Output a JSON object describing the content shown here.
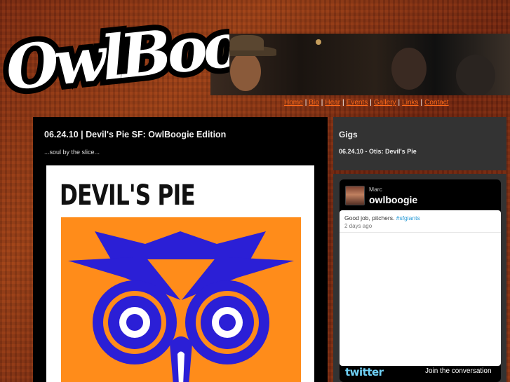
{
  "site": {
    "logo_text": "OwlBoogie"
  },
  "nav": {
    "items": [
      "Home",
      "Bio",
      "Hear",
      "Events",
      "Gallery",
      "Links",
      "Contact"
    ]
  },
  "post": {
    "title": "06.24.10 | Devil's Pie SF: OwlBoogie Edition",
    "subtitle": "...soul by the slice...",
    "poster_title": "DEVIL'S PIE"
  },
  "gigs": {
    "title": "Gigs",
    "item": "06.24.10 - Otis: Devil's Pie"
  },
  "twitter": {
    "name": "Marc",
    "handle": "owlboogie",
    "tweet_text": "Good job, pitchers. ",
    "tweet_hashtag": "#sfgiants",
    "tweet_time": "2 days ago",
    "logo": "twitter",
    "join": "Join the conversation"
  },
  "colors": {
    "accent": "#ff6a1a",
    "poster_orange": "#ff8c1a",
    "poster_blue": "#2b1fd6",
    "twitter_blue": "#2a9bd6"
  }
}
